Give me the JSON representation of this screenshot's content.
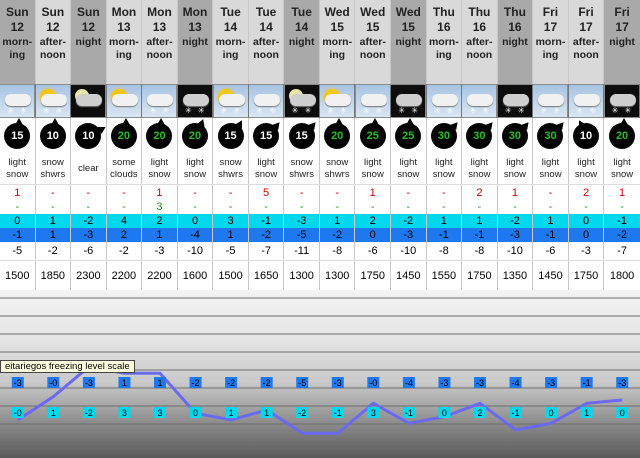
{
  "columns": [
    {
      "day": "Sun",
      "date": "12",
      "period": [
        "morn-",
        "ing"
      ],
      "shade": "dark",
      "icon": "snow-cloud-icon",
      "sky": "day",
      "wind": "15",
      "wind_strong": false,
      "wind_dir": 0,
      "summary": [
        "light",
        "snow"
      ],
      "snow": "1",
      "rain": "-",
      "max": "0",
      "min": "-1",
      "chill": "-5",
      "fl": "1500"
    },
    {
      "day": "Sun",
      "date": "12",
      "period": [
        "after-",
        "noon"
      ],
      "shade": "light",
      "icon": "sun-cloud-snow-icon",
      "sky": "day",
      "wind": "10",
      "wind_strong": false,
      "wind_dir": 0,
      "summary": [
        "snow",
        "shwrs"
      ],
      "snow": "-",
      "rain": "-",
      "max": "1",
      "min": "1",
      "chill": "-2",
      "fl": "1850"
    },
    {
      "day": "Sun",
      "date": "12",
      "period": [
        "",
        "night"
      ],
      "shade": "dark",
      "icon": "moon-cloud-icon",
      "sky": "night",
      "wind": "10",
      "wind_strong": false,
      "wind_dir": 60,
      "summary": [
        "clear",
        ""
      ],
      "snow": "-",
      "rain": "-",
      "max": "-2",
      "min": "-3",
      "chill": "-6",
      "fl": "2300"
    },
    {
      "day": "Mon",
      "date": "13",
      "period": [
        "morn-",
        "ing"
      ],
      "shade": "light",
      "icon": "sun-cloud-icon",
      "sky": "day",
      "wind": "20",
      "wind_strong": true,
      "wind_dir": 0,
      "summary": [
        "some",
        "clouds"
      ],
      "snow": "-",
      "rain": "-",
      "max": "4",
      "min": "2",
      "chill": "-2",
      "fl": "2200"
    },
    {
      "day": "Mon",
      "date": "13",
      "period": [
        "after-",
        "noon"
      ],
      "shade": "light",
      "icon": "snow-cloud-icon",
      "sky": "day",
      "wind": "20",
      "wind_strong": true,
      "wind_dir": 0,
      "summary": [
        "light",
        "snow"
      ],
      "snow": "1",
      "rain": "3",
      "max": "2",
      "min": "1",
      "chill": "-3",
      "fl": "2200"
    },
    {
      "day": "Mon",
      "date": "13",
      "period": [
        "",
        "night"
      ],
      "shade": "dark",
      "icon": "snow-cloud-icon",
      "sky": "night",
      "wind": "20",
      "wind_strong": true,
      "wind_dir": 20,
      "summary": [
        "light",
        "snow"
      ],
      "snow": "-",
      "rain": "-",
      "max": "0",
      "min": "-4",
      "chill": "-10",
      "fl": "1600"
    },
    {
      "day": "Tue",
      "date": "14",
      "period": [
        "morn-",
        "ing"
      ],
      "shade": "light",
      "icon": "sun-cloud-snow-icon",
      "sky": "day",
      "wind": "15",
      "wind_strong": false,
      "wind_dir": 30,
      "summary": [
        "snow",
        "shwrs"
      ],
      "snow": "-",
      "rain": "-",
      "max": "3",
      "min": "1",
      "chill": "-5",
      "fl": "1500"
    },
    {
      "day": "Tue",
      "date": "14",
      "period": [
        "after-",
        "noon"
      ],
      "shade": "light",
      "icon": "snow-cloud-icon",
      "sky": "day",
      "wind": "15",
      "wind_strong": false,
      "wind_dir": 40,
      "summary": [
        "light",
        "snow"
      ],
      "snow": "5",
      "rain": "-",
      "max": "-1",
      "min": "-2",
      "chill": "-7",
      "fl": "1650"
    },
    {
      "day": "Tue",
      "date": "14",
      "period": [
        "",
        "night"
      ],
      "shade": "dark",
      "icon": "moon-cloud-snow-icon",
      "sky": "night",
      "wind": "15",
      "wind_strong": false,
      "wind_dir": 40,
      "summary": [
        "snow",
        "shwrs"
      ],
      "snow": "-",
      "rain": "-",
      "max": "-3",
      "min": "-5",
      "chill": "-11",
      "fl": "1300"
    },
    {
      "day": "Wed",
      "date": "15",
      "period": [
        "morn-",
        "ing"
      ],
      "shade": "light",
      "icon": "sun-cloud-snow-icon",
      "sky": "day",
      "wind": "20",
      "wind_strong": true,
      "wind_dir": 0,
      "summary": [
        "snow",
        "shwrs"
      ],
      "snow": "-",
      "rain": "-",
      "max": "1",
      "min": "-2",
      "chill": "-8",
      "fl": "1300"
    },
    {
      "day": "Wed",
      "date": "15",
      "period": [
        "after-",
        "noon"
      ],
      "shade": "light",
      "icon": "snow-cloud-icon",
      "sky": "day",
      "wind": "25",
      "wind_strong": true,
      "wind_dir": 0,
      "summary": [
        "light",
        "snow"
      ],
      "snow": "1",
      "rain": "-",
      "max": "2",
      "min": "0",
      "chill": "-6",
      "fl": "1750"
    },
    {
      "day": "Wed",
      "date": "15",
      "period": [
        "",
        "night"
      ],
      "shade": "dark",
      "icon": "snow-cloud-icon",
      "sky": "night",
      "wind": "25",
      "wind_strong": true,
      "wind_dir": 0,
      "summary": [
        "light",
        "snow"
      ],
      "snow": "-",
      "rain": "-",
      "max": "-2",
      "min": "-3",
      "chill": "-10",
      "fl": "1450"
    },
    {
      "day": "Thu",
      "date": "16",
      "period": [
        "morn-",
        "ing"
      ],
      "shade": "light",
      "icon": "snow-cloud-icon",
      "sky": "day",
      "wind": "30",
      "wind_strong": true,
      "wind_dir": 40,
      "summary": [
        "light",
        "snow"
      ],
      "snow": "-",
      "rain": "-",
      "max": "1",
      "min": "-1",
      "chill": "-8",
      "fl": "1550"
    },
    {
      "day": "Thu",
      "date": "16",
      "period": [
        "after-",
        "noon"
      ],
      "shade": "light",
      "icon": "snow-cloud-icon",
      "sky": "day",
      "wind": "30",
      "wind_strong": true,
      "wind_dir": 40,
      "summary": [
        "light",
        "snow"
      ],
      "snow": "2",
      "rain": "-",
      "max": "1",
      "min": "-1",
      "chill": "-8",
      "fl": "1750"
    },
    {
      "day": "Thu",
      "date": "16",
      "period": [
        "",
        "night"
      ],
      "shade": "dark",
      "icon": "snow-cloud-icon",
      "sky": "night",
      "wind": "30",
      "wind_strong": true,
      "wind_dir": 40,
      "summary": [
        "light",
        "snow"
      ],
      "snow": "1",
      "rain": "-",
      "max": "-2",
      "min": "-3",
      "chill": "-10",
      "fl": "1350"
    },
    {
      "day": "Fri",
      "date": "17",
      "period": [
        "morn-",
        "ing"
      ],
      "shade": "light",
      "icon": "snow-cloud-icon",
      "sky": "day",
      "wind": "30",
      "wind_strong": true,
      "wind_dir": 40,
      "summary": [
        "light",
        "snow"
      ],
      "snow": "-",
      "rain": "-",
      "max": "1",
      "min": "-1",
      "chill": "-6",
      "fl": "1450"
    },
    {
      "day": "Fri",
      "date": "17",
      "period": [
        "after-",
        "noon"
      ],
      "shade": "light",
      "icon": "snow-cloud-icon",
      "sky": "day",
      "wind": "10",
      "wind_strong": false,
      "wind_dir": 330,
      "summary": [
        "light",
        "snow"
      ],
      "snow": "2",
      "rain": "-",
      "max": "0",
      "min": "0",
      "chill": "-3",
      "fl": "1750"
    },
    {
      "day": "Fri",
      "date": "17",
      "period": [
        "",
        "night"
      ],
      "shade": "dark",
      "icon": "snow-cloud-icon",
      "sky": "night",
      "wind": "20",
      "wind_strong": true,
      "wind_dir": 0,
      "summary": [
        "light",
        "snow"
      ],
      "snow": "1",
      "rain": "-",
      "max": "-1",
      "min": "-2",
      "chill": "-7",
      "fl": "1800"
    }
  ],
  "colors": {
    "max_row": "#00d8ee",
    "min_row": "#1e78f0",
    "snow_text": "#d00000",
    "rain_text": "#1b9c1b",
    "line": "#6a6af0"
  },
  "chart": {
    "tooltip": "eitariegos freezing level scale",
    "upper_labels": [
      "-3",
      "-0",
      "-3",
      "1",
      "1",
      "-2",
      "-2",
      "-2",
      "-5",
      "-3",
      "-0",
      "-4",
      "-3",
      "-3",
      "-4",
      "-3",
      "-1",
      "-3"
    ],
    "lower_labels": [
      "-0",
      "1",
      "-2",
      "3",
      "3",
      "0",
      "1",
      "1",
      "-2",
      "-1",
      "3",
      "-1",
      "0",
      "2",
      "-1",
      "0",
      "1",
      "0"
    ]
  }
}
